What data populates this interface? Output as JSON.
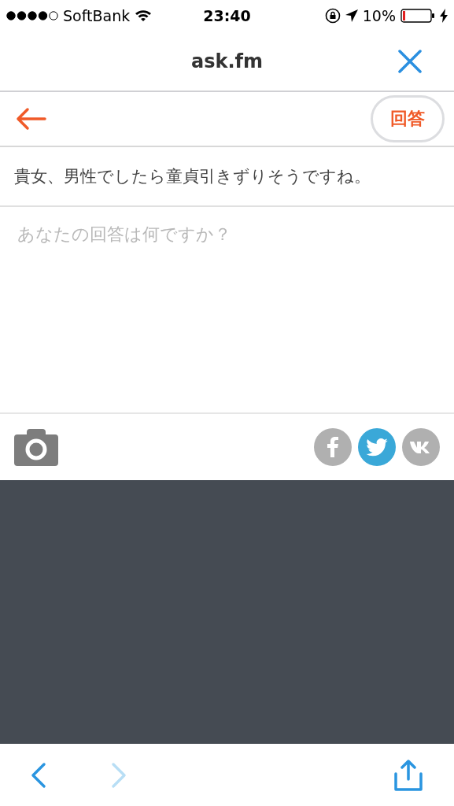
{
  "status_bar": {
    "carrier": "SoftBank",
    "time": "23:40",
    "battery": "10%"
  },
  "nav": {
    "title": "ask.fm"
  },
  "toolbar": {
    "answer_button": "回答"
  },
  "question": "貴女、男性でしたら童貞引きずりそうですね。",
  "answer": {
    "placeholder": "あなたの回答は何ですか？"
  },
  "share": [
    {
      "kind": "facebook",
      "on": false
    },
    {
      "kind": "twitter",
      "on": true
    },
    {
      "kind": "vk",
      "on": false
    }
  ],
  "browser_bar": {
    "back_disabled": false,
    "forward_disabled": true
  }
}
